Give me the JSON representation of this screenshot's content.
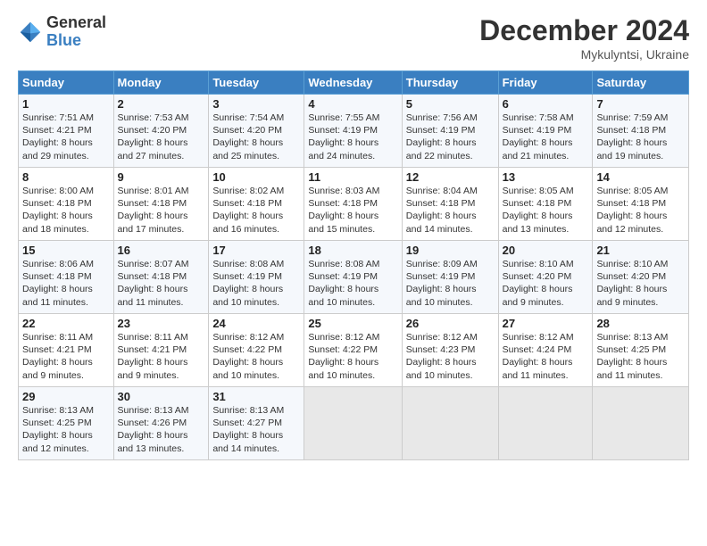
{
  "logo": {
    "general": "General",
    "blue": "Blue"
  },
  "title": "December 2024",
  "location": "Mykulyntsi, Ukraine",
  "days_header": [
    "Sunday",
    "Monday",
    "Tuesday",
    "Wednesday",
    "Thursday",
    "Friday",
    "Saturday"
  ],
  "weeks": [
    [
      {
        "day": "1",
        "info": "Sunrise: 7:51 AM\nSunset: 4:21 PM\nDaylight: 8 hours\nand 29 minutes."
      },
      {
        "day": "2",
        "info": "Sunrise: 7:53 AM\nSunset: 4:20 PM\nDaylight: 8 hours\nand 27 minutes."
      },
      {
        "day": "3",
        "info": "Sunrise: 7:54 AM\nSunset: 4:20 PM\nDaylight: 8 hours\nand 25 minutes."
      },
      {
        "day": "4",
        "info": "Sunrise: 7:55 AM\nSunset: 4:19 PM\nDaylight: 8 hours\nand 24 minutes."
      },
      {
        "day": "5",
        "info": "Sunrise: 7:56 AM\nSunset: 4:19 PM\nDaylight: 8 hours\nand 22 minutes."
      },
      {
        "day": "6",
        "info": "Sunrise: 7:58 AM\nSunset: 4:19 PM\nDaylight: 8 hours\nand 21 minutes."
      },
      {
        "day": "7",
        "info": "Sunrise: 7:59 AM\nSunset: 4:18 PM\nDaylight: 8 hours\nand 19 minutes."
      }
    ],
    [
      {
        "day": "8",
        "info": "Sunrise: 8:00 AM\nSunset: 4:18 PM\nDaylight: 8 hours\nand 18 minutes."
      },
      {
        "day": "9",
        "info": "Sunrise: 8:01 AM\nSunset: 4:18 PM\nDaylight: 8 hours\nand 17 minutes."
      },
      {
        "day": "10",
        "info": "Sunrise: 8:02 AM\nSunset: 4:18 PM\nDaylight: 8 hours\nand 16 minutes."
      },
      {
        "day": "11",
        "info": "Sunrise: 8:03 AM\nSunset: 4:18 PM\nDaylight: 8 hours\nand 15 minutes."
      },
      {
        "day": "12",
        "info": "Sunrise: 8:04 AM\nSunset: 4:18 PM\nDaylight: 8 hours\nand 14 minutes."
      },
      {
        "day": "13",
        "info": "Sunrise: 8:05 AM\nSunset: 4:18 PM\nDaylight: 8 hours\nand 13 minutes."
      },
      {
        "day": "14",
        "info": "Sunrise: 8:05 AM\nSunset: 4:18 PM\nDaylight: 8 hours\nand 12 minutes."
      }
    ],
    [
      {
        "day": "15",
        "info": "Sunrise: 8:06 AM\nSunset: 4:18 PM\nDaylight: 8 hours\nand 11 minutes."
      },
      {
        "day": "16",
        "info": "Sunrise: 8:07 AM\nSunset: 4:18 PM\nDaylight: 8 hours\nand 11 minutes."
      },
      {
        "day": "17",
        "info": "Sunrise: 8:08 AM\nSunset: 4:19 PM\nDaylight: 8 hours\nand 10 minutes."
      },
      {
        "day": "18",
        "info": "Sunrise: 8:08 AM\nSunset: 4:19 PM\nDaylight: 8 hours\nand 10 minutes."
      },
      {
        "day": "19",
        "info": "Sunrise: 8:09 AM\nSunset: 4:19 PM\nDaylight: 8 hours\nand 10 minutes."
      },
      {
        "day": "20",
        "info": "Sunrise: 8:10 AM\nSunset: 4:20 PM\nDaylight: 8 hours\nand 9 minutes."
      },
      {
        "day": "21",
        "info": "Sunrise: 8:10 AM\nSunset: 4:20 PM\nDaylight: 8 hours\nand 9 minutes."
      }
    ],
    [
      {
        "day": "22",
        "info": "Sunrise: 8:11 AM\nSunset: 4:21 PM\nDaylight: 8 hours\nand 9 minutes."
      },
      {
        "day": "23",
        "info": "Sunrise: 8:11 AM\nSunset: 4:21 PM\nDaylight: 8 hours\nand 9 minutes."
      },
      {
        "day": "24",
        "info": "Sunrise: 8:12 AM\nSunset: 4:22 PM\nDaylight: 8 hours\nand 10 minutes."
      },
      {
        "day": "25",
        "info": "Sunrise: 8:12 AM\nSunset: 4:22 PM\nDaylight: 8 hours\nand 10 minutes."
      },
      {
        "day": "26",
        "info": "Sunrise: 8:12 AM\nSunset: 4:23 PM\nDaylight: 8 hours\nand 10 minutes."
      },
      {
        "day": "27",
        "info": "Sunrise: 8:12 AM\nSunset: 4:24 PM\nDaylight: 8 hours\nand 11 minutes."
      },
      {
        "day": "28",
        "info": "Sunrise: 8:13 AM\nSunset: 4:25 PM\nDaylight: 8 hours\nand 11 minutes."
      }
    ],
    [
      {
        "day": "29",
        "info": "Sunrise: 8:13 AM\nSunset: 4:25 PM\nDaylight: 8 hours\nand 12 minutes."
      },
      {
        "day": "30",
        "info": "Sunrise: 8:13 AM\nSunset: 4:26 PM\nDaylight: 8 hours\nand 13 minutes."
      },
      {
        "day": "31",
        "info": "Sunrise: 8:13 AM\nSunset: 4:27 PM\nDaylight: 8 hours\nand 14 minutes."
      },
      {
        "day": "",
        "info": ""
      },
      {
        "day": "",
        "info": ""
      },
      {
        "day": "",
        "info": ""
      },
      {
        "day": "",
        "info": ""
      }
    ]
  ]
}
